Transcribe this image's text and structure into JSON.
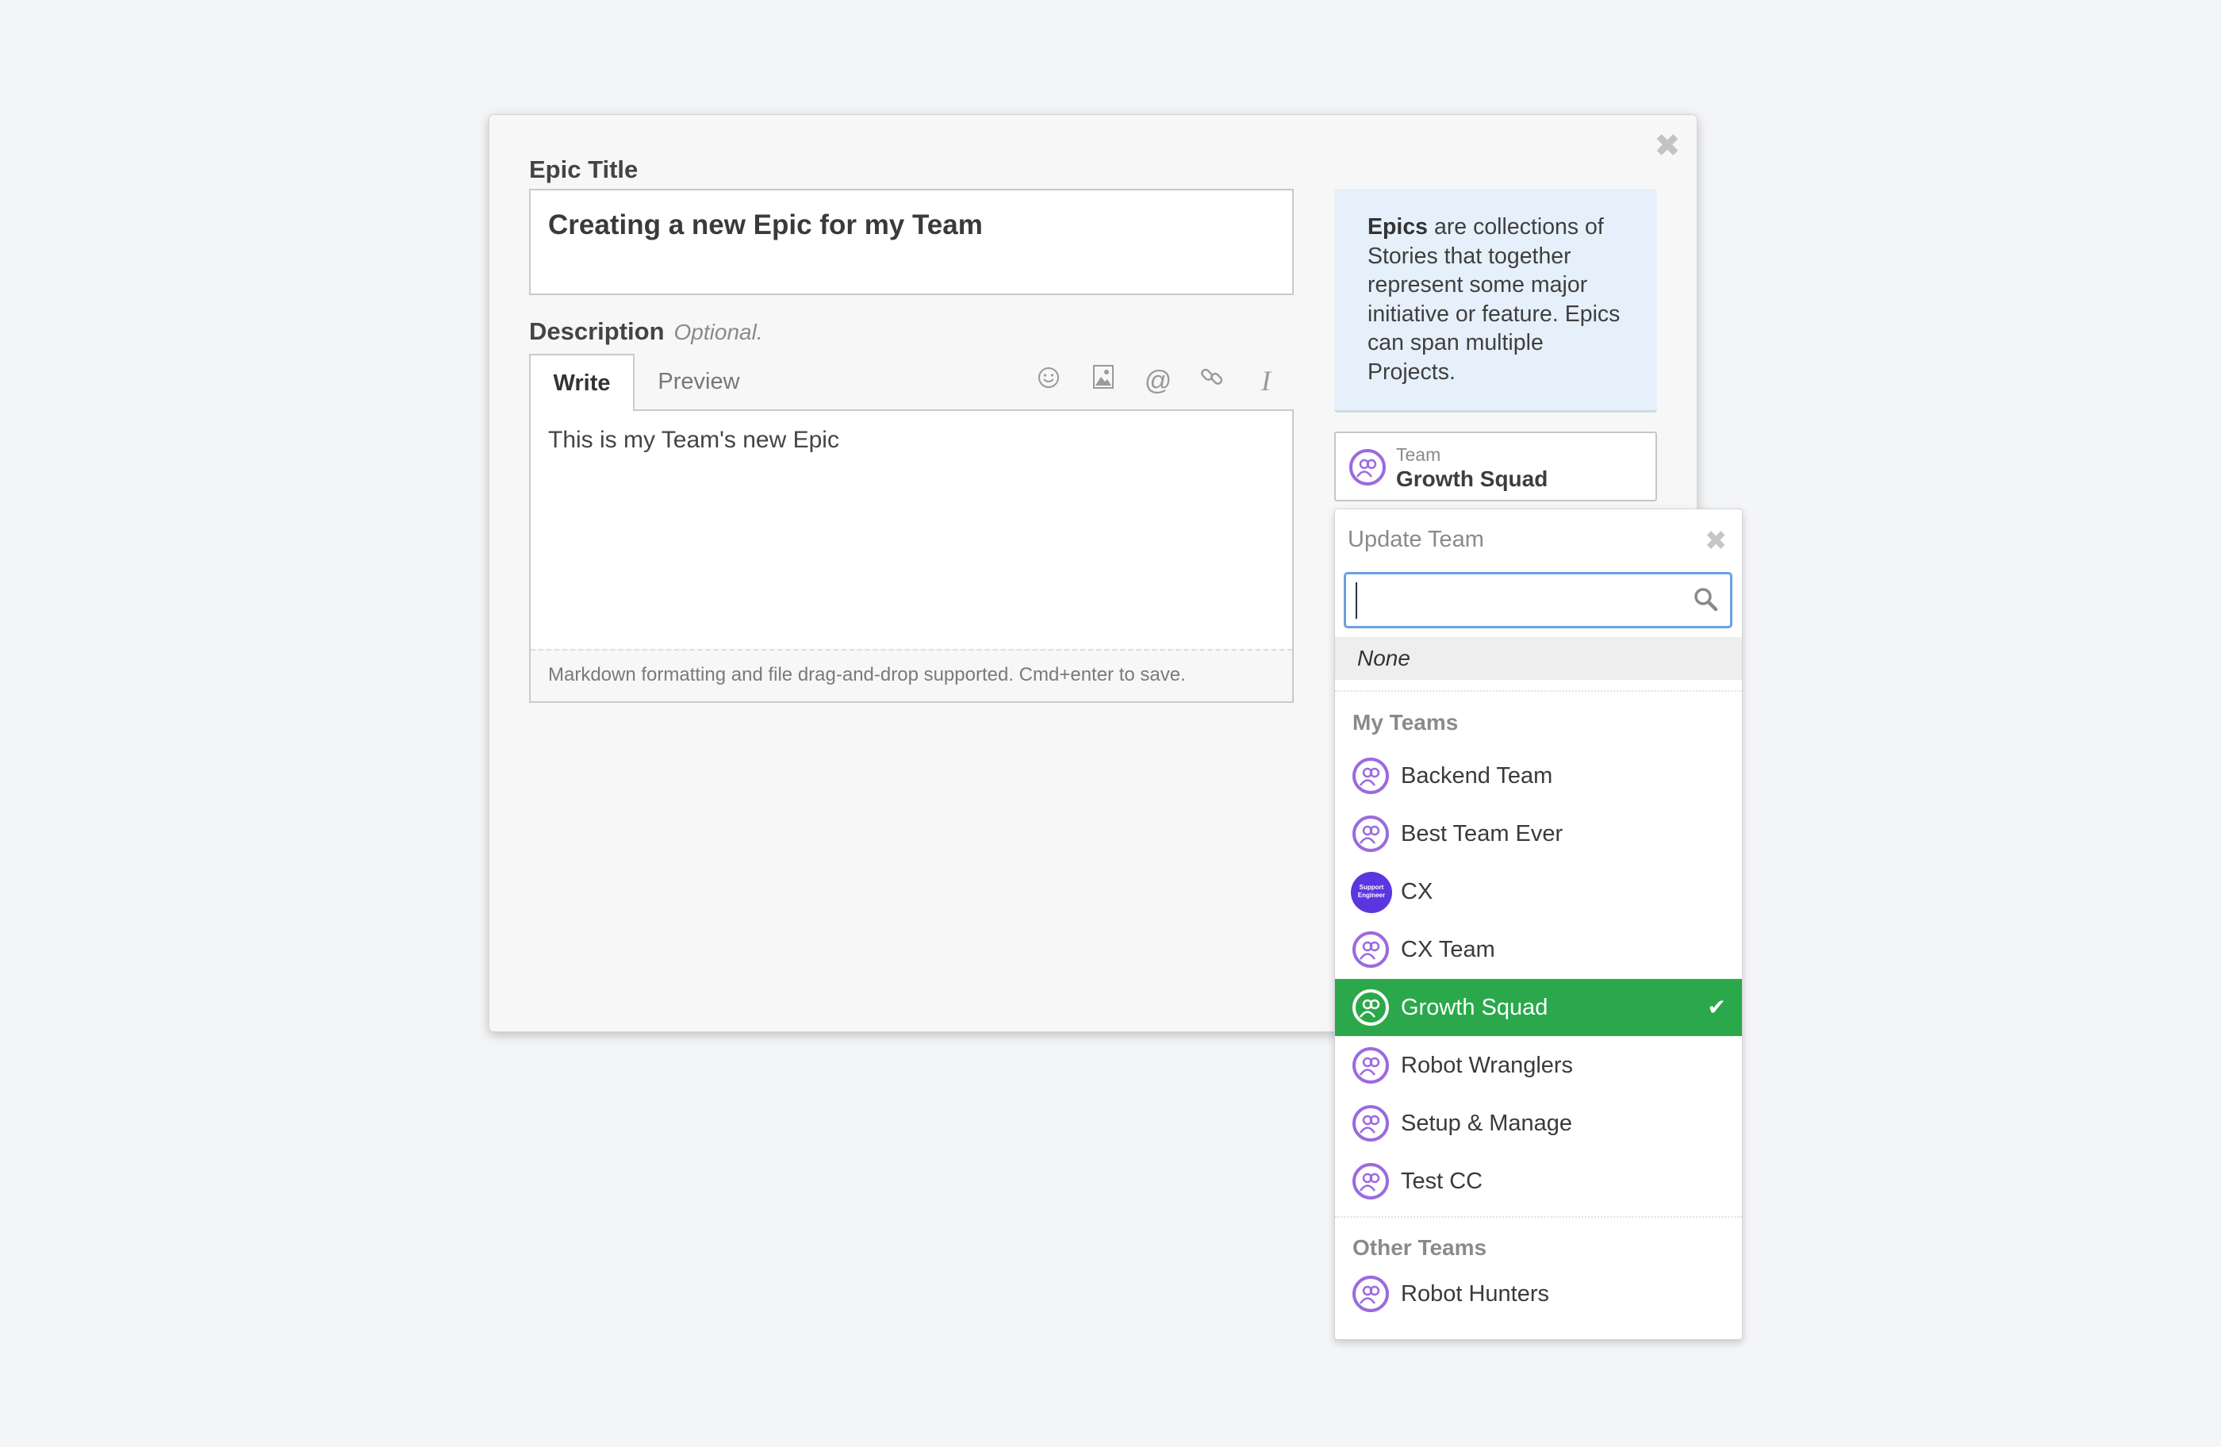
{
  "modal": {
    "close_glyph": "✖",
    "title_label": "Epic Title",
    "title_value": "Creating a new Epic for my Team",
    "description_label": "Description",
    "description_optional": "Optional.",
    "tabs": {
      "write": "Write",
      "preview": "Preview"
    },
    "toolbar_icons": [
      "emoji-icon",
      "image-icon",
      "mention-icon",
      "link-icon",
      "italic-icon"
    ],
    "description_value": "This is my Team's new Epic",
    "description_footer": "Markdown formatting and file drag-and-drop supported. Cmd+enter to save.",
    "info": {
      "bold": "Epics",
      "text": " are collections of Stories that together represent some major initiative or feature. Epics can span multiple Projects."
    },
    "team_field": {
      "label": "Team",
      "value": "Growth Squad"
    }
  },
  "dropdown": {
    "title": "Update Team",
    "close_glyph": "✖",
    "search_value": "",
    "none_label": "None",
    "my_teams_label": "My Teams",
    "my_teams": [
      {
        "name": "Backend Team",
        "avatar": "team-icon",
        "selected": false
      },
      {
        "name": "Best Team Ever",
        "avatar": "team-icon",
        "selected": false
      },
      {
        "name": "CX",
        "avatar": "support-engineer-avatar",
        "avatar_text": "Support Engineer",
        "selected": false
      },
      {
        "name": "CX Team",
        "avatar": "team-icon",
        "selected": false
      },
      {
        "name": "Growth Squad",
        "avatar": "team-icon",
        "selected": true
      },
      {
        "name": "Robot Wranglers",
        "avatar": "team-icon",
        "selected": false
      },
      {
        "name": "Setup & Manage",
        "avatar": "team-icon",
        "selected": false
      },
      {
        "name": "Test CC",
        "avatar": "team-icon",
        "selected": false
      }
    ],
    "other_teams_label": "Other Teams",
    "other_teams": [
      {
        "name": "Robot Hunters",
        "avatar": "team-icon",
        "selected": false
      }
    ],
    "check_glyph": "✔"
  },
  "colors": {
    "accent_purple": "#9b6ae0",
    "selected_green": "#2aa84b",
    "info_bg": "#e6f0fb",
    "search_focus": "#6aa0e3"
  }
}
